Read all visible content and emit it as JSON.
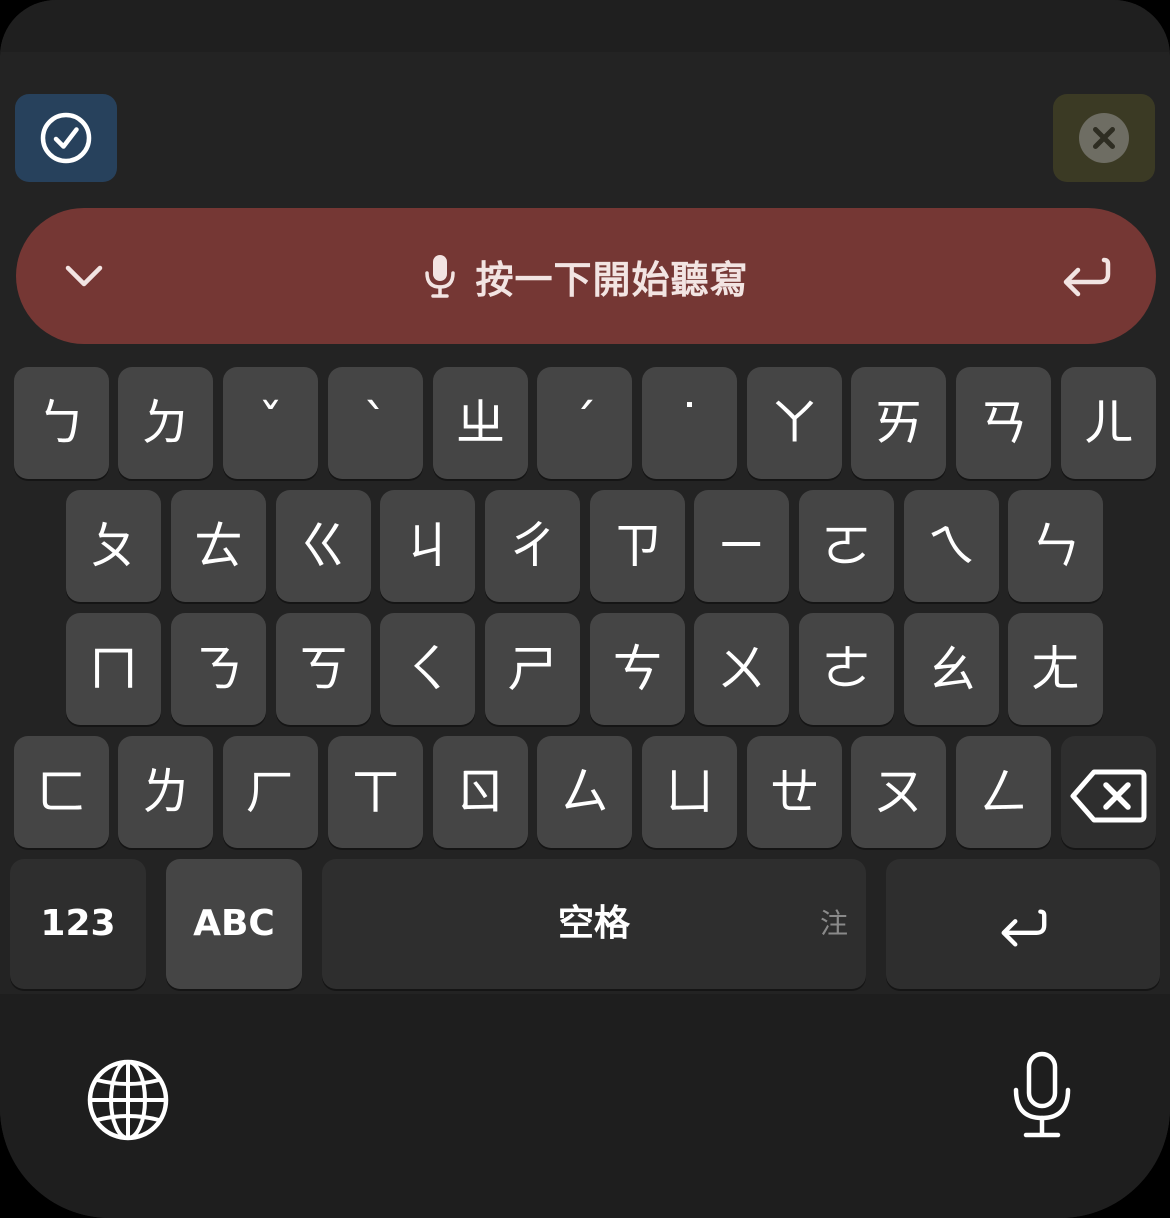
{
  "toolbar": {
    "confirm_icon": "checkmark-circle-icon",
    "cancel_icon": "close-circle-icon",
    "confirm_color": "#27415c",
    "cancel_color": "#3b3a24"
  },
  "dictation": {
    "label": "按一下開始聽寫",
    "color": "#753734"
  },
  "keyboard": {
    "row1": [
      "ㄅ",
      "ㄉ",
      "ˇ",
      "ˋ",
      "ㄓ",
      "ˊ",
      "˙",
      "ㄚ",
      "ㄞ",
      "ㄢ",
      "ㄦ"
    ],
    "row2": [
      "ㄆ",
      "ㄊ",
      "ㄍ",
      "ㄐ",
      "ㄔ",
      "ㄗ",
      "ㄧ",
      "ㄛ",
      "ㄟ",
      "ㄣ"
    ],
    "row3": [
      "ㄇ",
      "ㄋ",
      "ㄎ",
      "ㄑ",
      "ㄕ",
      "ㄘ",
      "ㄨ",
      "ㄜ",
      "ㄠ",
      "ㄤ"
    ],
    "row4": [
      "ㄈ",
      "ㄌ",
      "ㄏ",
      "ㄒ",
      "ㄖ",
      "ㄙ",
      "ㄩ",
      "ㄝ",
      "ㄡ",
      "ㄥ"
    ],
    "numbers_label": "123",
    "abc_label": "ABC",
    "space_label": "空格",
    "space_hint": "注"
  }
}
